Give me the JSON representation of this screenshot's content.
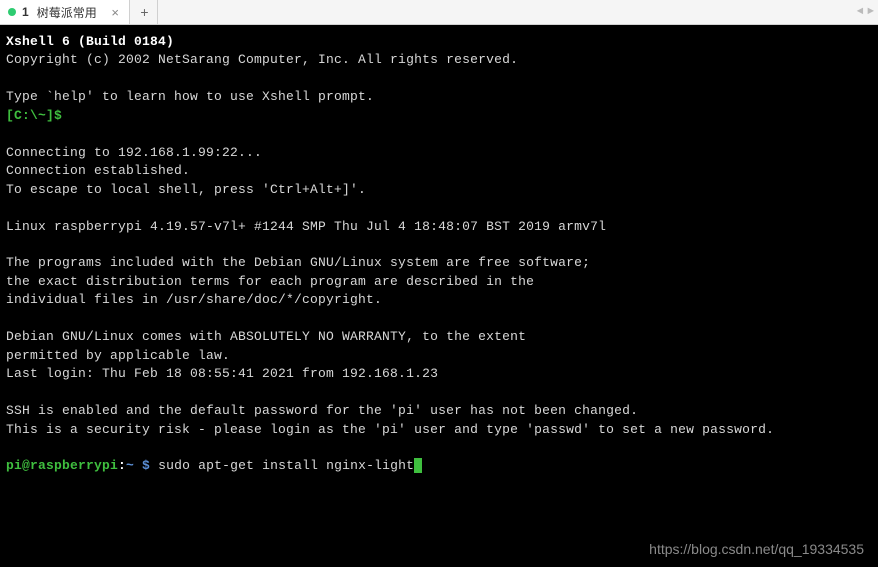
{
  "tabbar": {
    "tabs": [
      {
        "index": "1",
        "title": "树莓派常用"
      }
    ],
    "add_label": "+",
    "close_label": "×",
    "nav_prev": "◄",
    "nav_next": "►"
  },
  "terminal": {
    "banner_line1": "Xshell 6 (Build 0184)",
    "banner_line2": "Copyright (c) 2002 NetSarang Computer, Inc. All rights reserved.",
    "help_line": "Type `help' to learn how to use Xshell prompt.",
    "local_prompt": "[C:\\~]$",
    "connecting": "Connecting to 192.168.1.99:22...",
    "established": "Connection established.",
    "escape": "To escape to local shell, press 'Ctrl+Alt+]'.",
    "uname": "Linux raspberrypi 4.19.57-v7l+ #1244 SMP Thu Jul 4 18:48:07 BST 2019 armv7l",
    "motd1": "The programs included with the Debian GNU/Linux system are free software;",
    "motd2": "the exact distribution terms for each program are described in the",
    "motd3": "individual files in /usr/share/doc/*/copyright.",
    "motd4": "Debian GNU/Linux comes with ABSOLUTELY NO WARRANTY, to the extent",
    "motd5": "permitted by applicable law.",
    "last_login": "Last login: Thu Feb 18 08:55:41 2021 from 192.168.1.23",
    "ssh_warn1": "SSH is enabled and the default password for the 'pi' user has not been changed.",
    "ssh_warn2": "This is a security risk - please login as the 'pi' user and type 'passwd' to set a new password.",
    "prompt_user": "pi@raspberrypi",
    "prompt_sep": ":",
    "prompt_path": "~ $",
    "command": " sudo apt-get install nginx-light"
  },
  "watermark": "https://blog.csdn.net/qq_19334535"
}
